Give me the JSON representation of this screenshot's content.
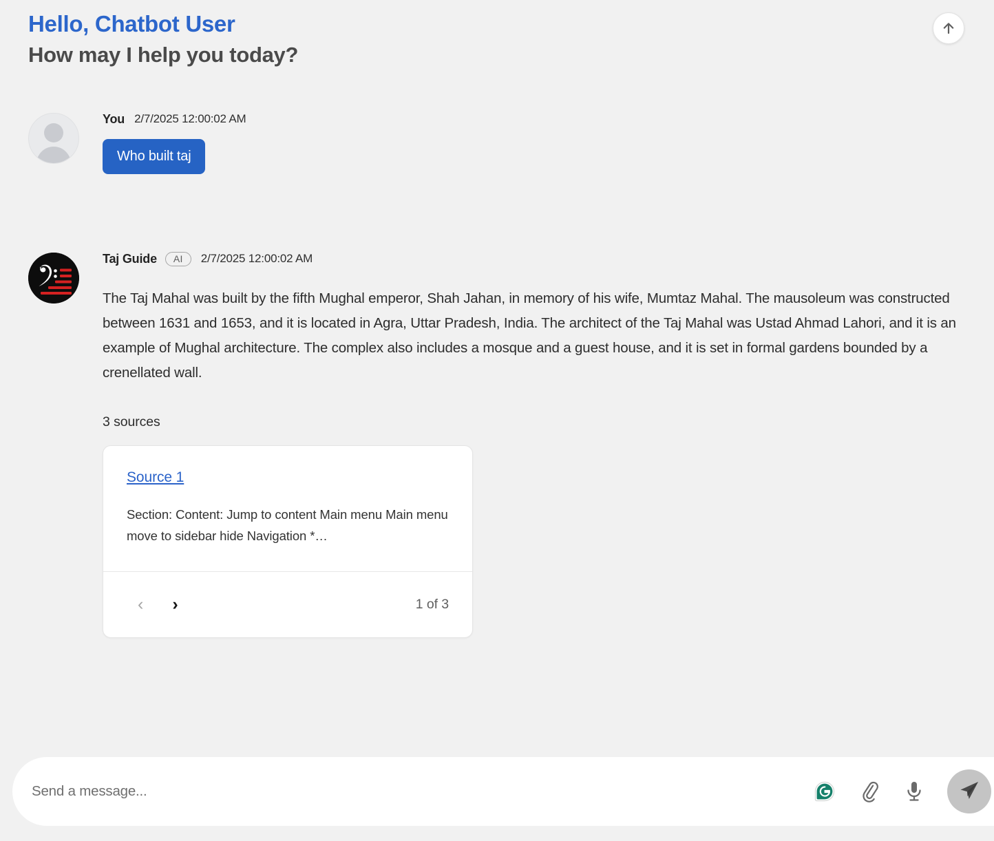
{
  "header": {
    "greeting": "Hello, Chatbot User",
    "subtitle": "How may I help you today?",
    "accent_color": "#2c66cb",
    "scroll_top_icon": "arrow-up-icon"
  },
  "messages": [
    {
      "sender": "You",
      "timestamp": "2/7/2025 12:00:02 AM",
      "text": "Who built taj",
      "avatar_icon": "user-avatar-icon",
      "bubble_color": "#2663c4"
    },
    {
      "sender": "Taj Guide",
      "badge": "AI",
      "timestamp": "2/7/2025 12:00:02 AM",
      "text": "The Taj Mahal was built by the fifth Mughal emperor, Shah Jahan, in memory of his wife, Mumtaz Mahal. The mausoleum was constructed between 1631 and 1653, and it is located in Agra, Uttar Pradesh, India. The architect of the Taj Mahal was Ustad Ahmad Lahori, and it is an example of Mughal architecture. The complex also includes a mosque and a guest house, and it is set in formal gardens bounded by a crenellated wall.",
      "avatar_icon": "bass-clef-logo-icon"
    }
  ],
  "sources": {
    "count_label": "3 sources",
    "card": {
      "link_label": "Source 1",
      "snippet": "Section: Content: Jump to content Main menu Main menu move to sidebar hide Navigation *…",
      "prev_icon": "chevron-left-icon",
      "next_icon": "chevron-right-icon",
      "prev_glyph": "‹",
      "next_glyph": "›",
      "pagination": "1 of 3",
      "link_color": "#2b63c9"
    }
  },
  "composer": {
    "placeholder": "Send a message...",
    "value": "",
    "actions": [
      {
        "name": "grammarly-icon",
        "label": "Grammarly"
      },
      {
        "name": "paperclip-icon",
        "label": "Attach file"
      },
      {
        "name": "microphone-icon",
        "label": "Voice input"
      },
      {
        "name": "send-icon",
        "label": "Send"
      }
    ],
    "send_button_color": "#c4c4c4",
    "grammarly_color": "#15806a"
  }
}
